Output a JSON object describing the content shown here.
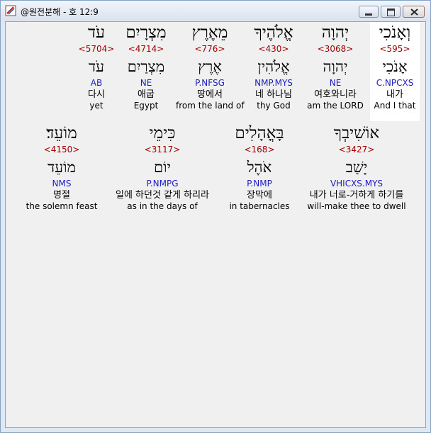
{
  "window": {
    "title": "@원전분해 - 호 12:9"
  },
  "words": [
    {
      "hebrew": "וְאָנֹכִי",
      "strong": "<595>",
      "lemma": "אָנֹכִי",
      "morph": "C.NPCXS",
      "korean": "내가",
      "english": "And I that"
    },
    {
      "hebrew": "יְהוָה",
      "strong": "<3068>",
      "lemma": "יְהוָה",
      "morph": "NE",
      "korean": "여호와니라",
      "english": "am the LORD"
    },
    {
      "hebrew": "אֱלֹהֶיךָ",
      "strong": "<430>",
      "lemma": "אֱלֹהִין",
      "morph": "NMP.MYS",
      "korean": "네 하나님",
      "english": "thy God"
    },
    {
      "hebrew": "מֵאֶרֶץ",
      "strong": "<776>",
      "lemma": "אֶרֶץ",
      "morph": "P.NFSG",
      "korean": "땅에서",
      "english": "from the land of"
    },
    {
      "hebrew": "מִצְרָיִם",
      "strong": "<4714>",
      "lemma": "מִצְרַיִם",
      "morph": "NE",
      "korean": "애굽",
      "english": "Egypt"
    },
    {
      "hebrew": "עֹד",
      "strong": "<5704>",
      "lemma": "עֹד",
      "morph": "AB",
      "korean": "다시",
      "english": "yet"
    },
    {
      "hebrew": "אוֹשִׁיבְךָ",
      "strong": "<3427>",
      "lemma": "יָשַׁב",
      "morph": "VHICXS.MYS",
      "korean": "내가 너로-거하게 하기를",
      "english": "will-make thee to dwell"
    },
    {
      "hebrew": "בָּאֳהָלִים",
      "strong": "<168>",
      "lemma": "אֹהֶל",
      "morph": "P.NMP",
      "korean": "장막에",
      "english": "in tabernacles"
    },
    {
      "hebrew": "כִּימֵי",
      "strong": "<3117>",
      "lemma": "יוֹם",
      "morph": "P.NMPG",
      "korean": "일에 하던것 같게 하리라",
      "english": "as in the days of"
    },
    {
      "hebrew": "מוֹעֵד׃",
      "strong": "<4150>",
      "lemma": "מוֹעֵד",
      "morph": "NMS",
      "korean": "명절",
      "english": "the solemn feast"
    }
  ]
}
